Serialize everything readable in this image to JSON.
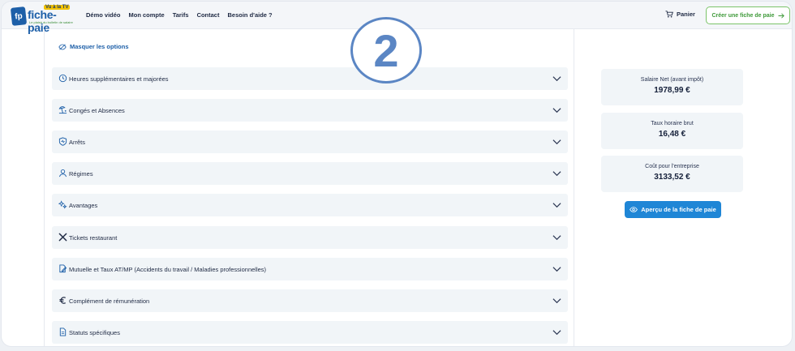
{
  "logo": {
    "badge": "fp",
    "name": "fiche-paie",
    "tv": "Vu à la TV",
    "tagline": "Le plaisir du bulletin de salaire"
  },
  "nav": [
    "Démo vidéo",
    "Mon compte",
    "Tarifs",
    "Contact",
    "Besoin d'aide ?"
  ],
  "header": {
    "cart_label": "Panier",
    "cta_label": "Créer une fiche de paie"
  },
  "main": {
    "mask_options_label": "Masquer les options",
    "sections": [
      {
        "label": "Heures supplémentaires et majorées",
        "icon": "clock-icon"
      },
      {
        "label": "Congés et Absences",
        "icon": "beach-icon"
      },
      {
        "label": "Arrêts",
        "icon": "health-shield-icon"
      },
      {
        "label": "Régimes",
        "icon": "user-icon"
      },
      {
        "label": "Avantages",
        "icon": "sparkle-icon"
      },
      {
        "label": "Tickets restaurant",
        "icon": "cutlery-icon"
      },
      {
        "label": "Mutuelle et Taux AT/MP (Accidents du travail / Maladies professionnelles)",
        "icon": "document-pen-icon"
      },
      {
        "label": "Complément de rémunération",
        "icon": "euro-icon"
      },
      {
        "label": "Statuts spécifiques",
        "icon": "document-icon"
      }
    ]
  },
  "step_badge": "2",
  "summary": {
    "cards": [
      {
        "title": "Salaire Net (avant impôt)",
        "value": "1978,99 €"
      },
      {
        "title": "Taux horaire brut",
        "value": "16,48 €"
      },
      {
        "title": "Coût pour l'entreprise",
        "value": "3133,52 €"
      }
    ],
    "preview_label": "Aperçu de la fiche de paie"
  },
  "colors": {
    "accent": "#1f86d6",
    "brand": "#1d5fa8",
    "cta_green": "#3f9a3a",
    "badge": "#5b86c4",
    "row_bg": "#f1f5f8"
  }
}
